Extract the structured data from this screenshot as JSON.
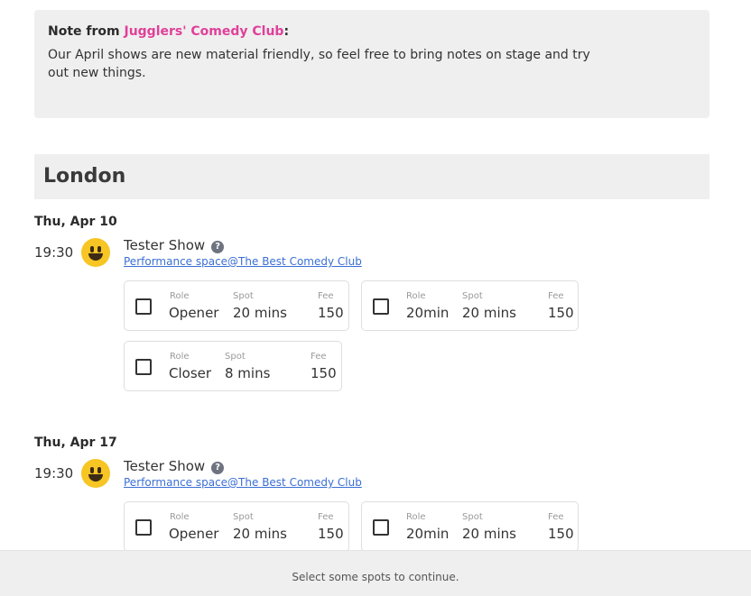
{
  "note": {
    "prefix": "Note from ",
    "club": "Jugglers' Comedy Club",
    "suffix": ":",
    "body": "Our April shows are new material friendly, so feel free to bring notes on stage and try out new things."
  },
  "city": "London",
  "shows": [
    {
      "date": "Thu, Apr 10",
      "time": "19:30",
      "title": "Tester Show",
      "help_glyph": "?",
      "venue": "Performance space@The Best Comedy Club",
      "spots": [
        {
          "role_label": "Role",
          "role": "Opener",
          "spot_label": "Spot",
          "spot": "20 mins",
          "fee_label": "Fee",
          "fee": "150"
        },
        {
          "role_label": "Role",
          "role": "20min",
          "spot_label": "Spot",
          "spot": "20 mins",
          "fee_label": "Fee",
          "fee": "150"
        },
        {
          "role_label": "Role",
          "role": "Closer",
          "spot_label": "Spot",
          "spot": "8 mins",
          "fee_label": "Fee",
          "fee": "150"
        }
      ]
    },
    {
      "date": "Thu, Apr 17",
      "time": "19:30",
      "title": "Tester Show",
      "help_glyph": "?",
      "venue": "Performance space@The Best Comedy Club",
      "spots": [
        {
          "role_label": "Role",
          "role": "Opener",
          "spot_label": "Spot",
          "spot": "20 mins",
          "fee_label": "Fee",
          "fee": "150"
        },
        {
          "role_label": "Role",
          "role": "20min",
          "spot_label": "Spot",
          "spot": "20 mins",
          "fee_label": "Fee",
          "fee": "150"
        }
      ]
    }
  ],
  "footer": "Select some spots to continue.",
  "colors": {
    "accent": "#e0409a",
    "link": "#3b6fd4",
    "panel": "#efefef"
  }
}
